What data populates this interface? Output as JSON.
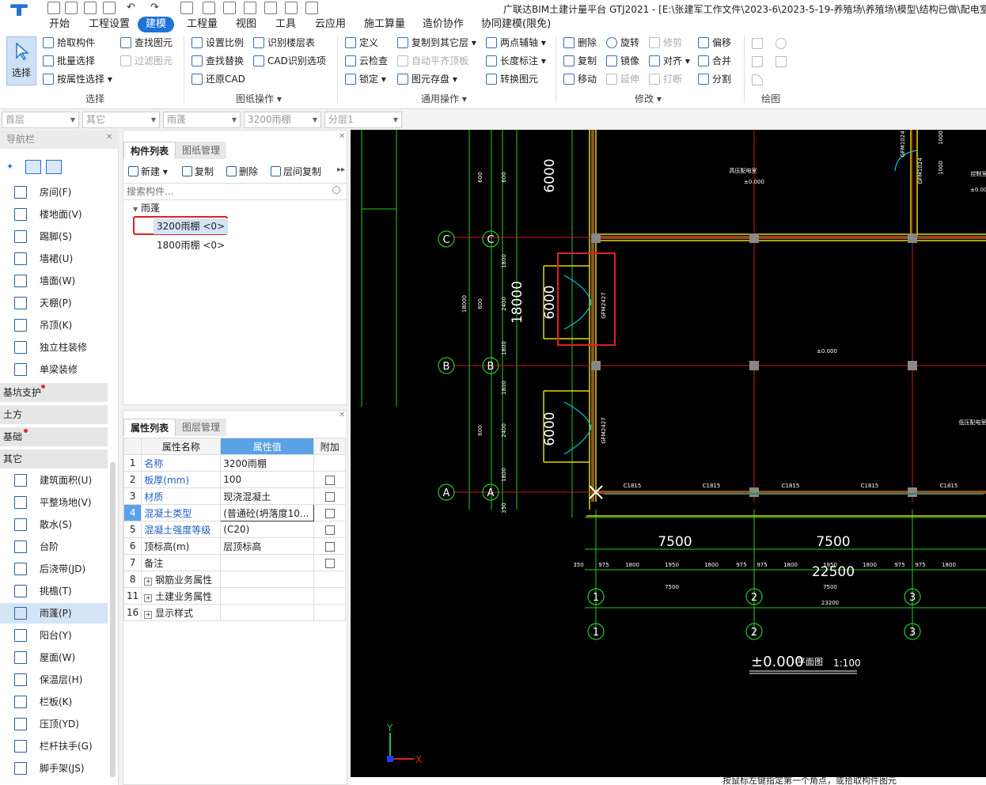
{
  "window": {
    "title": "广联达BIM土建计量平台 GTJ2021 - [E:\\张建军工作文件\\2023-6\\2023-5-19-养殖场\\养殖场\\模型\\结构已做\\配电室"
  },
  "menu": {
    "tabs": [
      "开始",
      "工程设置",
      "建模",
      "工程量",
      "视图",
      "工具",
      "云应用",
      "施工算量",
      "造价协作",
      "协同建模(限免)"
    ],
    "active": "建模"
  },
  "ribbon": {
    "select": "选择",
    "select_group": {
      "label": "选择",
      "items": [
        "拾取构件",
        "批量选择",
        "按属性选择",
        "查找图元",
        "过滤图元"
      ]
    },
    "drawing_group": {
      "label": "图纸操作",
      "items": [
        "设置比例",
        "识别楼层表",
        "查找替换",
        "CAD识别选项",
        "还原CAD"
      ]
    },
    "common_group": {
      "label": "通用操作",
      "items": [
        "定义",
        "复制到其它层",
        "两点辅轴",
        "云检查",
        "自动平齐顶板",
        "长度标注",
        "锁定",
        "图元存盘",
        "转换图元"
      ]
    },
    "modify_group": {
      "label": "修改",
      "items": [
        "删除",
        "旋转",
        "修剪",
        "偏移",
        "复制",
        "镜像",
        "对齐",
        "合并",
        "移动",
        "延伸",
        "打断",
        "分割"
      ]
    },
    "draw_group": {
      "label": "绘图"
    }
  },
  "filters": [
    "首层",
    "其它",
    "雨蓬",
    "3200雨棚",
    "分层1"
  ],
  "nav": {
    "title": "导航栏",
    "items_top": [
      "房间(F)",
      "楼地面(V)",
      "踢脚(S)",
      "墙裙(U)",
      "墙面(W)",
      "天棚(P)",
      "吊顶(K)",
      "独立柱装修",
      "单梁装修"
    ],
    "categories": [
      "基坑支护",
      "土方",
      "基础",
      "其它"
    ],
    "items_other": [
      "建筑面积(U)",
      "平整场地(V)",
      "散水(S)",
      "台阶",
      "后浇带(JD)",
      "挑檐(T)",
      "雨蓬(P)",
      "阳台(Y)",
      "屋面(W)",
      "保温层(H)",
      "栏板(K)",
      "压顶(YD)",
      "栏杆扶手(G)",
      "脚手架(JS)"
    ],
    "selected": "雨蓬(P)"
  },
  "component_panel": {
    "tabs": [
      "构件列表",
      "图纸管理"
    ],
    "toolbar": [
      "新建",
      "复制",
      "删除",
      "层间复制"
    ],
    "search_placeholder": "搜索构件...",
    "tree_root": "雨蓬",
    "items": [
      "3200雨棚 <0>",
      "1800雨棚 <0>"
    ]
  },
  "property_panel": {
    "tabs": [
      "属性列表",
      "图层管理"
    ],
    "headers": [
      "属性名称",
      "属性值",
      "附加"
    ],
    "rows": [
      {
        "no": "1",
        "name": "名称",
        "value": "3200雨棚",
        "blue": true,
        "cb": false
      },
      {
        "no": "2",
        "name": "板厚(mm)",
        "value": "100",
        "blue": true,
        "cb": true
      },
      {
        "no": "3",
        "name": "材质",
        "value": "现浇混凝土",
        "blue": true,
        "cb": true
      },
      {
        "no": "4",
        "name": "混凝土类型",
        "value": "(普通砼(坍落度10...",
        "blue": true,
        "cb": true
      },
      {
        "no": "5",
        "name": "混凝土强度等级",
        "value": "(C20)",
        "blue": true,
        "cb": true
      },
      {
        "no": "6",
        "name": "顶标高(m)",
        "value": "层顶标高",
        "blue": false,
        "cb": true
      },
      {
        "no": "7",
        "name": "备注",
        "value": "",
        "blue": false,
        "cb": true
      },
      {
        "no": "8",
        "name": "钢筋业务属性",
        "value": "",
        "blue": false,
        "cb": false,
        "expand": true
      },
      {
        "no": "11",
        "name": "土建业务属性",
        "value": "",
        "blue": false,
        "cb": false,
        "expand": true
      },
      {
        "no": "16",
        "name": "显示样式",
        "value": "",
        "blue": false,
        "cb": false,
        "expand": true
      }
    ]
  },
  "cad": {
    "axis_rows": [
      "C",
      "B",
      "A"
    ],
    "axis_cols": [
      "1",
      "2",
      "3"
    ],
    "span_labels": [
      "7500",
      "7500"
    ],
    "total_label": "22500",
    "sub_dims": [
      "975",
      "1800",
      "1950",
      "1800",
      "975",
      "975",
      "1800",
      "1950",
      "1800",
      "975",
      "975",
      "1800"
    ],
    "left_dim": "350",
    "small_dims": [
      "7500",
      "7500",
      "23200"
    ],
    "vert_dims": [
      "6000",
      "18000",
      "6000",
      "6000"
    ],
    "vert_small": [
      "600",
      "600",
      "1800",
      "2400",
      "1800",
      "1800",
      "2400",
      "1800",
      "600",
      "600",
      "350",
      "18000"
    ],
    "window_tags": [
      "C1815",
      "C1815",
      "C1815",
      "C1815",
      "C1815"
    ],
    "door_tags": [
      "GFM2427",
      "GFM2427",
      "GFM1024",
      "GFM1024"
    ],
    "room_label": "高压配电室",
    "room_label2": "低压配电室",
    "room_label3": "控制室",
    "elev_labels": [
      "±0.000",
      "±0.000",
      "±0.000"
    ],
    "small_dims2": [
      "1000",
      "1000"
    ],
    "plan_title": "±0.000",
    "plan_sub": "平面图",
    "scale": "1:100",
    "ucs_x": "X",
    "ucs_y": "Y"
  },
  "status": {
    "text": "按鼠标左键指定第一个角点，或拾取构件图元"
  }
}
